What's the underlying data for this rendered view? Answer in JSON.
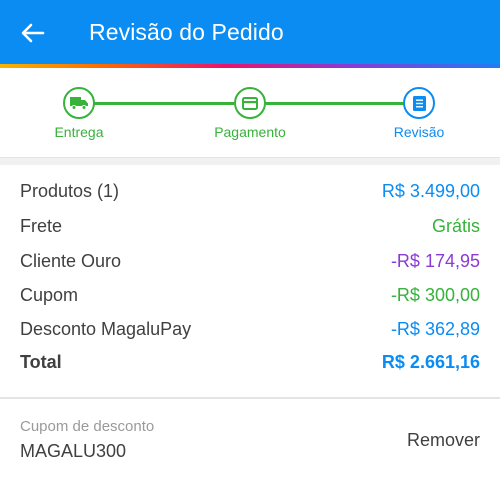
{
  "header": {
    "title": "Revisão do Pedido",
    "back_icon": "arrow-left-icon",
    "background": "#0a8cf3"
  },
  "stepper": {
    "steps": [
      {
        "label": "Entrega",
        "icon": "truck-icon",
        "color": "#37b23b",
        "status": "completed"
      },
      {
        "label": "Pagamento",
        "icon": "credit-card-icon",
        "color": "#37b23b",
        "status": "completed"
      },
      {
        "label": "Revisão",
        "icon": "list-icon",
        "color": "#0a8cf3",
        "status": "current"
      }
    ]
  },
  "summary": {
    "products": {
      "label": "Produtos (1)",
      "value": "R$ 3.499,00"
    },
    "shipping": {
      "label": "Frete",
      "value": "Grátis"
    },
    "gold_client": {
      "label": "Cliente Ouro",
      "value": "-R$ 174,95"
    },
    "coupon": {
      "label": "Cupom",
      "value": "-R$ 300,00"
    },
    "magalupay": {
      "label": "Desconto MagaluPay",
      "value": "-R$ 362,89"
    },
    "total": {
      "label": "Total",
      "value": "R$ 2.661,16"
    }
  },
  "coupon_section": {
    "caption": "Cupom de desconto",
    "code": "MAGALU300",
    "remove_label": "Remover"
  }
}
